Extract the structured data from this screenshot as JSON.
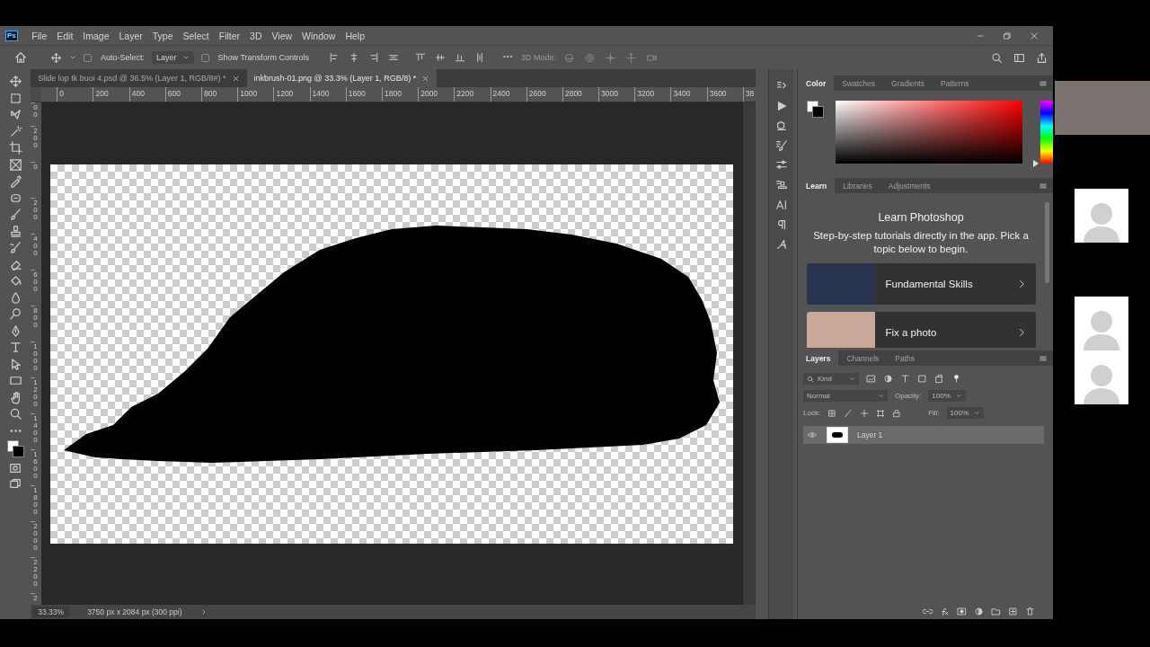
{
  "app_logo": "Ps",
  "menu": [
    "File",
    "Edit",
    "Image",
    "Layer",
    "Type",
    "Select",
    "Filter",
    "3D",
    "View",
    "Window",
    "Help"
  ],
  "options_bar": {
    "auto_select": {
      "label": "Auto-Select:",
      "checked": false
    },
    "target": "Layer",
    "show_transform": {
      "label": "Show Transform Controls",
      "checked": false
    },
    "mode_label": "3D Mode:"
  },
  "document_tabs": [
    {
      "label": "Slide lop tk buoi 4.psd @ 36.5% (Layer 1, RGB/8#) *",
      "selected": false
    },
    {
      "label": "inkbrush-01.png @ 33.3% (Layer 1, RGB/8) *",
      "selected": true
    }
  ],
  "rulers": {
    "horizontal": [
      "0",
      "200",
      "400",
      "600",
      "800",
      "1000",
      "1200",
      "1400",
      "1600",
      "1800",
      "2000",
      "2200",
      "2400",
      "2600",
      "2800",
      "3000",
      "3200",
      "3400",
      "3600",
      "38"
    ],
    "vertical": [
      "00",
      "200",
      "0",
      "200",
      "400",
      "600",
      "800",
      "1000",
      "1200",
      "1400",
      "1600",
      "1800",
      "2000",
      "2200",
      "2"
    ]
  },
  "color_panel": {
    "hue_slider": {
      "level": 0
    },
    "tabs": [
      {
        "label": "Color",
        "selected": true
      },
      {
        "label": "Swatches",
        "selected": false
      },
      {
        "label": "Gradients",
        "selected": false
      },
      {
        "label": "Patterns",
        "selected": false
      }
    ]
  },
  "learn_panel": {
    "tabs": [
      {
        "label": "Learn",
        "selected": true
      },
      {
        "label": "Libraries",
        "selected": false
      },
      {
        "label": "Adjustments",
        "selected": false
      }
    ],
    "title": "Learn Photoshop",
    "description": "Step-by-step tutorials directly in the app. Pick a topic below to begin.",
    "tutorials": [
      {
        "label": "Fundamental Skills"
      },
      {
        "label": "Fix a photo"
      }
    ]
  },
  "layers_panel": {
    "tabs": [
      {
        "label": "Layers",
        "selected": true
      },
      {
        "label": "Channels",
        "selected": false
      },
      {
        "label": "Paths",
        "selected": false
      }
    ],
    "filter": "Kind",
    "blend_mode": "Normal",
    "opacity_label": "Opacity:",
    "opacity": "100%",
    "lock_label": "Lock:",
    "fill_label": "Fill:",
    "fill": "100%",
    "layers": [
      {
        "name": "Layer 1",
        "visible": true,
        "selected": true
      }
    ]
  },
  "status_bar": {
    "zoom": "33.33%",
    "info": "3750 px x 2084 px (300 ppi)"
  },
  "video_tiles": [
    {
      "kind": "camera"
    },
    {
      "kind": "avatar"
    },
    {
      "kind": "avatar"
    },
    {
      "kind": "avatar"
    }
  ]
}
